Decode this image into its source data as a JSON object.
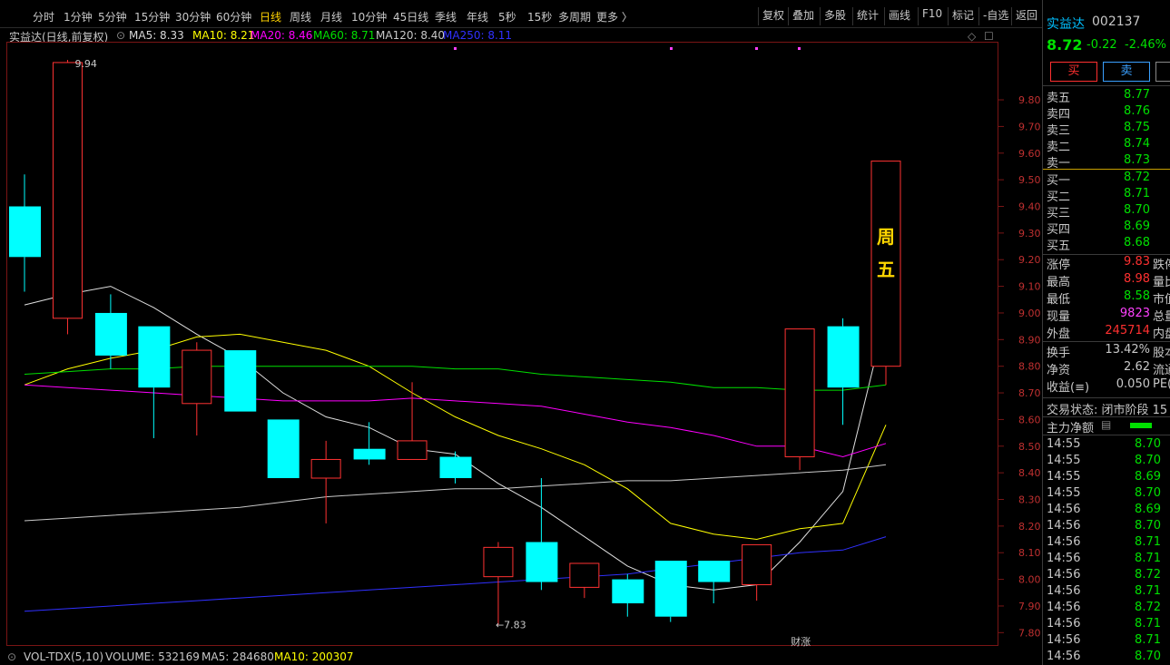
{
  "toolbar": {
    "timeframes": [
      "分时",
      "1分钟",
      "5分钟",
      "15分钟",
      "30分钟",
      "60分钟",
      "日线",
      "周线",
      "月线",
      "10分钟",
      "45日线",
      "季线",
      "年线",
      "5秒",
      "15秒",
      "多周期",
      "更多 〉"
    ],
    "active_timeframe": "日线",
    "tools": [
      "复权",
      "叠加",
      "多股",
      "统计",
      "画线",
      "F10",
      "标记",
      "-自选",
      "返回"
    ]
  },
  "ma_header": {
    "name": "实益达(日线,前复权)",
    "items": [
      {
        "label": "MA5: 8.33",
        "color": "#d8d8d8"
      },
      {
        "label": "MA10: 8.21",
        "color": "#ffff00"
      },
      {
        "label": "MA20: 8.46",
        "color": "#ff00ff"
      },
      {
        "label": "MA60: 8.71",
        "color": "#00e000"
      },
      {
        "label": "MA120: 8.40",
        "color": "#c8c8c8"
      },
      {
        "label": "MA250: 8.11",
        "color": "#3030ff"
      }
    ]
  },
  "chart_data": {
    "type": "candlestick",
    "ylim": [
      7.75,
      9.95
    ],
    "y_ticks": [
      "9.80",
      "9.70",
      "9.60",
      "9.50",
      "9.40",
      "9.30",
      "9.20",
      "9.10",
      "9.00",
      "8.90",
      "8.80",
      "8.70",
      "8.60",
      "8.50",
      "8.40",
      "8.30",
      "8.20",
      "8.10",
      "8.00",
      "7.90",
      "7.80"
    ],
    "candles": [
      {
        "o": 9.4,
        "h": 9.52,
        "l": 9.08,
        "c": 9.21
      },
      {
        "o": 8.98,
        "h": 9.95,
        "l": 8.92,
        "c": 9.94
      },
      {
        "o": 9.0,
        "h": 9.07,
        "l": 8.79,
        "c": 8.84
      },
      {
        "o": 8.95,
        "h": 8.95,
        "l": 8.53,
        "c": 8.72
      },
      {
        "o": 8.66,
        "h": 8.89,
        "l": 8.54,
        "c": 8.86
      },
      {
        "o": 8.86,
        "h": 8.86,
        "l": 8.63,
        "c": 8.63
      },
      {
        "o": 8.6,
        "h": 8.6,
        "l": 8.38,
        "c": 8.38
      },
      {
        "o": 8.38,
        "h": 8.52,
        "l": 8.21,
        "c": 8.45
      },
      {
        "o": 8.49,
        "h": 8.59,
        "l": 8.43,
        "c": 8.45
      },
      {
        "o": 8.45,
        "h": 8.74,
        "l": 8.45,
        "c": 8.52
      },
      {
        "o": 8.46,
        "h": 8.48,
        "l": 8.36,
        "c": 8.38
      },
      {
        "o": 8.01,
        "h": 8.14,
        "l": 7.83,
        "c": 8.12
      },
      {
        "o": 8.14,
        "h": 8.38,
        "l": 7.96,
        "c": 7.99
      },
      {
        "o": 7.97,
        "h": 8.06,
        "l": 7.93,
        "c": 8.06
      },
      {
        "o": 8.0,
        "h": 8.02,
        "l": 7.86,
        "c": 7.91
      },
      {
        "o": 8.07,
        "h": 8.07,
        "l": 7.84,
        "c": 7.86
      },
      {
        "o": 8.07,
        "h": 8.07,
        "l": 7.91,
        "c": 7.99
      },
      {
        "o": 7.98,
        "h": 8.13,
        "l": 7.92,
        "c": 8.13
      },
      {
        "o": 8.46,
        "h": 8.94,
        "l": 8.41,
        "c": 8.94
      },
      {
        "o": 8.95,
        "h": 8.98,
        "l": 8.58,
        "c": 8.72
      },
      {
        "o": 8.8,
        "h": 9.57,
        "l": 8.73,
        "c": 9.57
      }
    ],
    "ma": [
      {
        "name": "MA5",
        "color": "#e0e0e0",
        "values": [
          9.03,
          9.07,
          9.1,
          9.02,
          8.92,
          8.83,
          8.7,
          8.61,
          8.57,
          8.49,
          8.47,
          8.36,
          8.27,
          8.16,
          8.05,
          7.98,
          7.96,
          7.98,
          8.14,
          8.33,
          8.99
        ]
      },
      {
        "name": "MA10",
        "color": "#ffff00",
        "values": [
          8.73,
          8.79,
          8.83,
          8.86,
          8.91,
          8.92,
          8.89,
          8.86,
          8.8,
          8.7,
          8.61,
          8.54,
          8.49,
          8.43,
          8.34,
          8.21,
          8.17,
          8.15,
          8.19,
          8.21,
          8.58
        ]
      },
      {
        "name": "MA20",
        "color": "#ff00ff",
        "values": [
          8.73,
          8.72,
          8.71,
          8.7,
          8.69,
          8.68,
          8.67,
          8.67,
          8.67,
          8.68,
          8.67,
          8.66,
          8.65,
          8.62,
          8.59,
          8.57,
          8.54,
          8.5,
          8.5,
          8.46,
          8.51
        ]
      },
      {
        "name": "MA60",
        "color": "#00e000",
        "values": [
          8.77,
          8.78,
          8.79,
          8.79,
          8.8,
          8.8,
          8.8,
          8.8,
          8.8,
          8.8,
          8.79,
          8.79,
          8.77,
          8.76,
          8.75,
          8.74,
          8.72,
          8.72,
          8.71,
          8.71,
          8.73
        ]
      },
      {
        "name": "MA120",
        "color": "#c8c8c8",
        "values": [
          8.22,
          8.23,
          8.24,
          8.25,
          8.26,
          8.27,
          8.29,
          8.31,
          8.32,
          8.33,
          8.34,
          8.34,
          8.35,
          8.36,
          8.37,
          8.37,
          8.38,
          8.39,
          8.4,
          8.41,
          8.43
        ]
      },
      {
        "name": "MA250",
        "color": "#3030ff",
        "values": [
          7.88,
          7.89,
          7.9,
          7.91,
          7.92,
          7.93,
          7.94,
          7.95,
          7.96,
          7.97,
          7.98,
          7.99,
          8.0,
          8.01,
          8.02,
          8.04,
          8.06,
          8.08,
          8.1,
          8.11,
          8.16
        ]
      }
    ],
    "annotations": {
      "high_label": "9.94",
      "low_label": "←7.83",
      "week_label_1": "周",
      "week_label_2": "五",
      "event_label": "财涨"
    }
  },
  "volume_header": {
    "name": "VOL-TDX(5,10)",
    "volume": "VOLUME: 532169",
    "ma5": "MA5: 284680",
    "ma10": "MA10: 200307"
  },
  "quote": {
    "name": "实益达",
    "code": "002137",
    "price": "8.72",
    "change": "-0.22",
    "pct": "-2.46%",
    "buy_label": "买",
    "sell_label": "卖",
    "asks": [
      {
        "label": "卖五",
        "price": "8.77"
      },
      {
        "label": "卖四",
        "price": "8.76"
      },
      {
        "label": "卖三",
        "price": "8.75"
      },
      {
        "label": "卖二",
        "price": "8.74"
      },
      {
        "label": "卖一",
        "price": "8.73"
      }
    ],
    "bids": [
      {
        "label": "买一",
        "price": "8.72"
      },
      {
        "label": "买二",
        "price": "8.71"
      },
      {
        "label": "买三",
        "price": "8.70"
      },
      {
        "label": "买四",
        "price": "8.69"
      },
      {
        "label": "买五",
        "price": "8.68"
      }
    ],
    "stats": [
      {
        "label": "涨停",
        "value": "9.83",
        "color": "#ff3030",
        "extra": "跌停"
      },
      {
        "label": "最高",
        "value": "8.98",
        "color": "#ff3030",
        "extra": "量比"
      },
      {
        "label": "最低",
        "value": "8.58",
        "color": "#00e000",
        "extra": "市值"
      },
      {
        "label": "现量",
        "value": "9823",
        "color": "#ff40ff",
        "extra": "总量"
      },
      {
        "label": "外盘",
        "value": "245714",
        "color": "#ff3030",
        "extra": "内盘"
      }
    ],
    "stats2": [
      {
        "label": "换手",
        "value": "13.42%",
        "extra": "股本"
      },
      {
        "label": "净资",
        "value": "2.62",
        "extra": "流通"
      },
      {
        "label": "收益(≡)",
        "value": "0.050",
        "extra": "PE("
      }
    ],
    "trade_status": "交易状态: 闭市阶段 15",
    "main_flow": "主力净额",
    "ticks": [
      {
        "t": "14:55",
        "p": "8.70"
      },
      {
        "t": "14:55",
        "p": "8.70"
      },
      {
        "t": "14:55",
        "p": "8.69"
      },
      {
        "t": "14:55",
        "p": "8.70"
      },
      {
        "t": "14:56",
        "p": "8.69"
      },
      {
        "t": "14:56",
        "p": "8.70"
      },
      {
        "t": "14:56",
        "p": "8.71"
      },
      {
        "t": "14:56",
        "p": "8.71"
      },
      {
        "t": "14:56",
        "p": "8.72"
      },
      {
        "t": "14:56",
        "p": "8.71"
      },
      {
        "t": "14:56",
        "p": "8.72"
      },
      {
        "t": "14:56",
        "p": "8.71"
      },
      {
        "t": "14:56",
        "p": "8.71"
      },
      {
        "t": "14:56",
        "p": "8.70"
      }
    ]
  }
}
